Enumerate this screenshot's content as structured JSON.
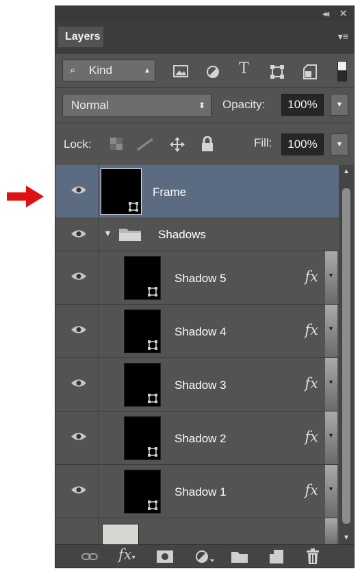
{
  "panel": {
    "tab_label": "Layers",
    "collapse_icon": "double-chevron-left-icon",
    "close_icon": "close-icon",
    "menu_icon": "panel-menu-icon"
  },
  "filter": {
    "kind_label": "Kind",
    "icons": [
      "pixel-layer-filter-icon",
      "adjustment-layer-filter-icon",
      "type-layer-filter-icon",
      "shape-layer-filter-icon",
      "smart-object-filter-icon",
      "filter-toggle-icon"
    ]
  },
  "blend": {
    "mode": "Normal",
    "opacity_label": "Opacity:",
    "opacity_value": "100%"
  },
  "lock": {
    "label": "Lock:",
    "icons": [
      "lock-transparent-pixels-icon",
      "lock-image-pixels-icon",
      "lock-position-icon",
      "lock-all-icon"
    ],
    "fill_label": "Fill:",
    "fill_value": "100%"
  },
  "layers": [
    {
      "name": "Frame",
      "selected": true
    },
    {
      "name": "Shadows",
      "type": "group"
    },
    {
      "name": "Shadow 5",
      "fx": "fx"
    },
    {
      "name": "Shadow 4",
      "fx": "fx"
    },
    {
      "name": "Shadow 3",
      "fx": "fx"
    },
    {
      "name": "Shadow 2",
      "fx": "fx"
    },
    {
      "name": "Shadow 1",
      "fx": "fx"
    }
  ],
  "bottom_icons": [
    "link-layers-icon",
    "layer-style-fx-icon",
    "layer-mask-icon",
    "adjustment-layer-icon",
    "new-group-icon",
    "new-layer-icon",
    "trash-icon"
  ],
  "colors": {
    "panel_bg": "#535353",
    "selected_layer": "#5b6b82",
    "annotation_arrow": "#e01010"
  }
}
